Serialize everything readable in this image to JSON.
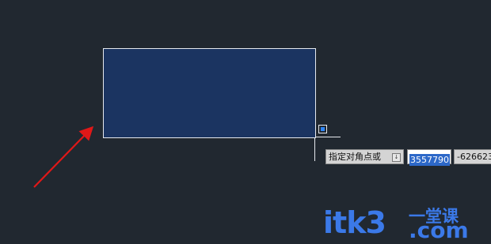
{
  "canvas": {
    "background": "#212830"
  },
  "selection": {
    "fill": "#1b3461",
    "border": "#e6e9ee"
  },
  "command_prompt": {
    "label": "指定对角点或",
    "dropdown_icon": "small-down-arrow-icon",
    "x_value": "3557790",
    "y_value": "-626623"
  },
  "annotation": {
    "arrow_color": "#e01818"
  },
  "watermark": {
    "brand": "itk3",
    "cn": "一堂课",
    "com": ".com",
    "color": "#3b79e8"
  }
}
